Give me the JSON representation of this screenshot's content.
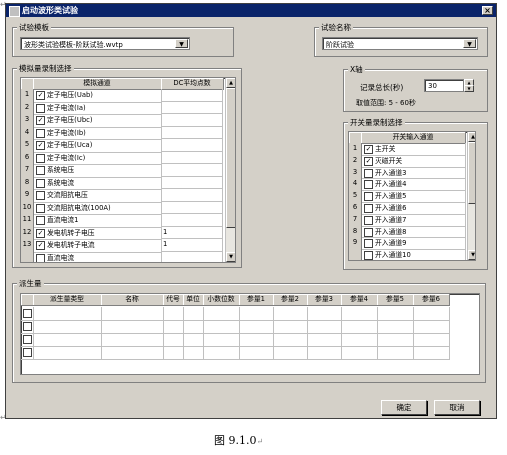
{
  "window_title": "启动波形类试验",
  "close_glyph": "×",
  "left_template": {
    "label": "试验模板",
    "value": "波形类试验模板-阶跃试验.wvtp"
  },
  "right_test": {
    "label": "试验名称",
    "value": "阶跃试验"
  },
  "analog": {
    "title": "模拟量录制选择",
    "col_channel": "模拟通道",
    "col_dc": "DC平均点数",
    "rows": [
      {
        "n": "1",
        "checked": true,
        "name": "定子电压(Uab)",
        "dc": ""
      },
      {
        "n": "2",
        "checked": false,
        "name": "定子电流(Ia)",
        "dc": ""
      },
      {
        "n": "3",
        "checked": true,
        "name": "定子电压(Ubc)",
        "dc": ""
      },
      {
        "n": "4",
        "checked": false,
        "name": "定子电流(Ib)",
        "dc": ""
      },
      {
        "n": "5",
        "checked": true,
        "name": "定子电压(Uca)",
        "dc": ""
      },
      {
        "n": "6",
        "checked": false,
        "name": "定子电流(Ic)",
        "dc": ""
      },
      {
        "n": "7",
        "checked": false,
        "name": "系统电压",
        "dc": ""
      },
      {
        "n": "8",
        "checked": false,
        "name": "系统电流",
        "dc": ""
      },
      {
        "n": "9",
        "checked": false,
        "name": "交流阻抗电压",
        "dc": ""
      },
      {
        "n": "10",
        "checked": false,
        "name": "交流阻抗电流(100A)",
        "dc": ""
      },
      {
        "n": "11",
        "checked": false,
        "name": "直流电流1",
        "dc": ""
      },
      {
        "n": "12",
        "checked": true,
        "name": "发电机转子电压",
        "dc": "1"
      },
      {
        "n": "13",
        "checked": true,
        "name": "发电机转子电流",
        "dc": "1"
      },
      {
        "n": "",
        "checked": false,
        "name": "直流电流",
        "dc": ""
      }
    ]
  },
  "xaxis": {
    "title": "X轴",
    "total_label": "记录总长(秒)",
    "total_value": "30",
    "range_label": "取值范围: 5 - 60秒"
  },
  "switch": {
    "title": "开关量录制选择",
    "col_channel": "开关输入通道",
    "rows": [
      {
        "n": "1",
        "checked": true,
        "name": "主开关"
      },
      {
        "n": "2",
        "checked": true,
        "name": "灭磁开关"
      },
      {
        "n": "3",
        "checked": false,
        "name": "开入通道3"
      },
      {
        "n": "4",
        "checked": false,
        "name": "开入通道4"
      },
      {
        "n": "5",
        "checked": false,
        "name": "开入通道5"
      },
      {
        "n": "6",
        "checked": false,
        "name": "开入通道6"
      },
      {
        "n": "7",
        "checked": false,
        "name": "开入通道7"
      },
      {
        "n": "8",
        "checked": false,
        "name": "开入通道8"
      },
      {
        "n": "9",
        "checked": false,
        "name": "开入通道9"
      },
      {
        "n": "",
        "checked": false,
        "name": "开入通道10"
      }
    ]
  },
  "derived": {
    "title": "派生量",
    "headers": [
      "派生量类型",
      "名称",
      "代号",
      "单位",
      "小数位数",
      "参量1",
      "参量2",
      "参量3",
      "参量4",
      "参量5",
      "参量6"
    ],
    "row_count": 4
  },
  "buttons": {
    "ok": "确定",
    "cancel": "取消"
  },
  "caption": "图 9.1.0",
  "para_mark": "↵"
}
